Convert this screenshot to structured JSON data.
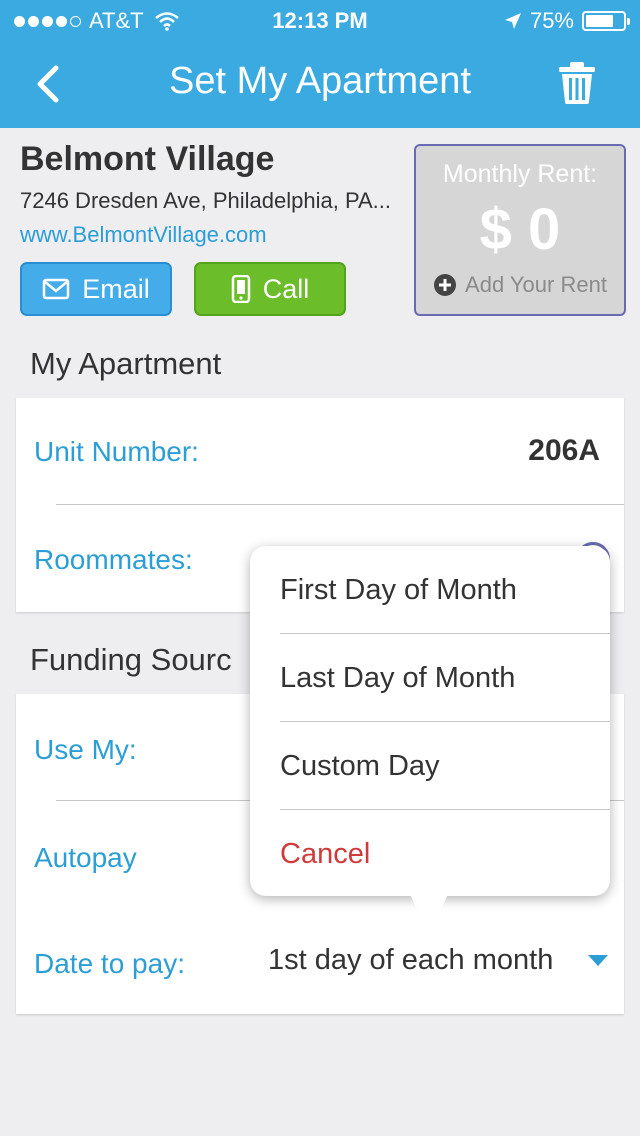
{
  "status_bar": {
    "carrier": "AT&T",
    "time": "12:13 PM",
    "battery": "75%",
    "battery_level": 0.75
  },
  "nav": {
    "title": "Set My Apartment",
    "back_icon": "chevron-left-icon",
    "trash_icon": "trash-icon"
  },
  "property": {
    "name": "Belmont Village",
    "address": "7246 Dresden Ave, Philadelphia, PA...",
    "website": "www.BelmontVillage.com",
    "email_label": "Email",
    "call_label": "Call"
  },
  "rent": {
    "label": "Monthly Rent:",
    "value": "$ 0",
    "add_label": "Add Your Rent"
  },
  "apartment": {
    "section_title": "My Apartment",
    "unit_label": "Unit Number:",
    "unit_value": "206A",
    "roommates_label": "Roommates:"
  },
  "funding": {
    "section_title": "Funding Sourc",
    "use_my_label": "Use My:",
    "autopay_label": "Autopay",
    "date_label": "Date to pay:",
    "date_value": "1st day of each month"
  },
  "popover": {
    "options": [
      "First Day of Month",
      "Last Day of Month",
      "Custom Day"
    ],
    "cancel": "Cancel"
  },
  "colors": {
    "header": "#3aaae1",
    "link": "#2c9ed6",
    "email_button": "#45acea",
    "call_button": "#6bbd2a",
    "cancel": "#d03a3a"
  }
}
